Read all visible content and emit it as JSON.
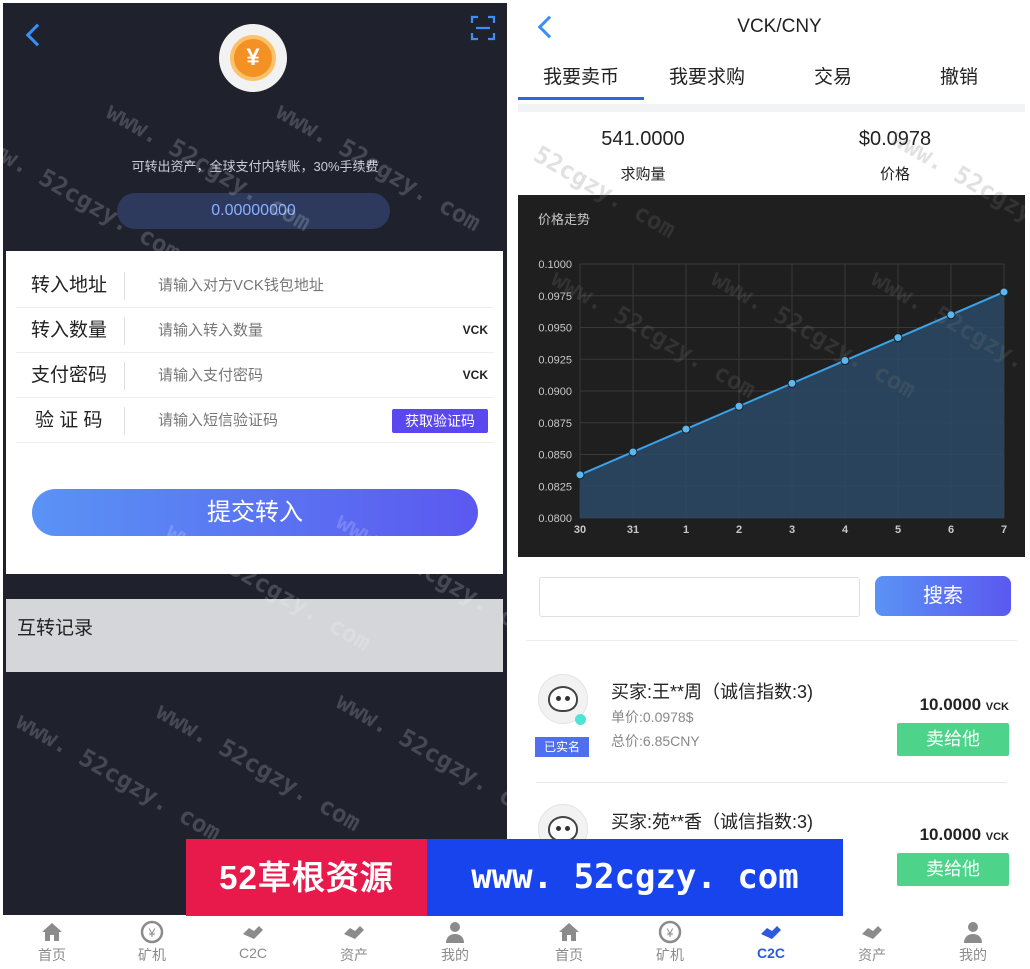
{
  "left_panel": {
    "coin_symbol": "¥",
    "transfer_note": "可转出资产，全球支付内转账，30%手续费",
    "balance": "0.00000000",
    "form": {
      "address_label": "转入地址",
      "address_placeholder": "请输入对方VCK钱包地址",
      "amount_label": "转入数量",
      "amount_placeholder": "请输入转入数量",
      "amount_unit": "VCK",
      "password_label": "支付密码",
      "password_placeholder": "请输入支付密码",
      "password_unit": "VCK",
      "code_label": "验 证 码",
      "code_placeholder": "请输入短信验证码",
      "code_button": "获取验证码",
      "submit_label": "提交转入"
    },
    "record_title": "互转记录"
  },
  "right_panel": {
    "pair_title": "VCK/CNY",
    "tabs": [
      {
        "label": "我要卖币",
        "active": true
      },
      {
        "label": "我要求购",
        "active": false
      },
      {
        "label": "交易",
        "active": false
      },
      {
        "label": "撤销",
        "active": false
      }
    ],
    "stats": {
      "volume_value": "541.0000",
      "volume_label": "求购量",
      "price_value": "$0.0978",
      "price_label": "价格"
    },
    "search_button": "搜索",
    "orders": [
      {
        "buyer": "买家:王**周（诚信指数:3)",
        "unit_price": "单价:0.0978$",
        "total_price": "总价:6.85CNY",
        "amount": "10.0000",
        "amount_unit": "VCK",
        "verified": "已实名",
        "action": "卖给他"
      },
      {
        "buyer": "买家:苑**香（诚信指数:3)",
        "amount": "10.0000",
        "amount_unit": "VCK",
        "action": "卖给他"
      }
    ]
  },
  "chart_data": {
    "type": "area",
    "title": "价格走势",
    "categories": [
      "30",
      "31",
      "1",
      "2",
      "3",
      "4",
      "5",
      "6",
      "7"
    ],
    "values": [
      0.0834,
      0.0852,
      0.087,
      0.0888,
      0.0906,
      0.0924,
      0.0942,
      0.096,
      0.0978
    ],
    "ylim": [
      0.08,
      0.1
    ],
    "yticks": [
      "0.1000",
      "0.0975",
      "0.0950",
      "0.0925",
      "0.0900",
      "0.0875",
      "0.0850",
      "0.0825",
      "0.0800"
    ],
    "grid": true,
    "colors": {
      "line": "#3aa3e8",
      "fill": "#2a4a66",
      "background": "#1f1f1f"
    }
  },
  "bottom_nav": {
    "left": [
      {
        "label": "首页",
        "icon": "home-icon"
      },
      {
        "label": "矿机",
        "icon": "miner-icon"
      },
      {
        "label": "C2C",
        "icon": "c2c-icon"
      },
      {
        "label": "资产",
        "icon": "asset-icon"
      },
      {
        "label": "我的",
        "icon": "user-icon"
      }
    ],
    "right": [
      {
        "label": "首页",
        "icon": "home-icon"
      },
      {
        "label": "矿机",
        "icon": "miner-icon"
      },
      {
        "label": "C2C",
        "icon": "c2c-icon",
        "active": true
      },
      {
        "label": "资产",
        "icon": "asset-icon"
      },
      {
        "label": "我的",
        "icon": "user-icon"
      }
    ]
  },
  "banner": {
    "left_text": "52草根资源",
    "right_text": "www. 52cgzy. com"
  },
  "watermark_text": "www. 52cgzy. com"
}
